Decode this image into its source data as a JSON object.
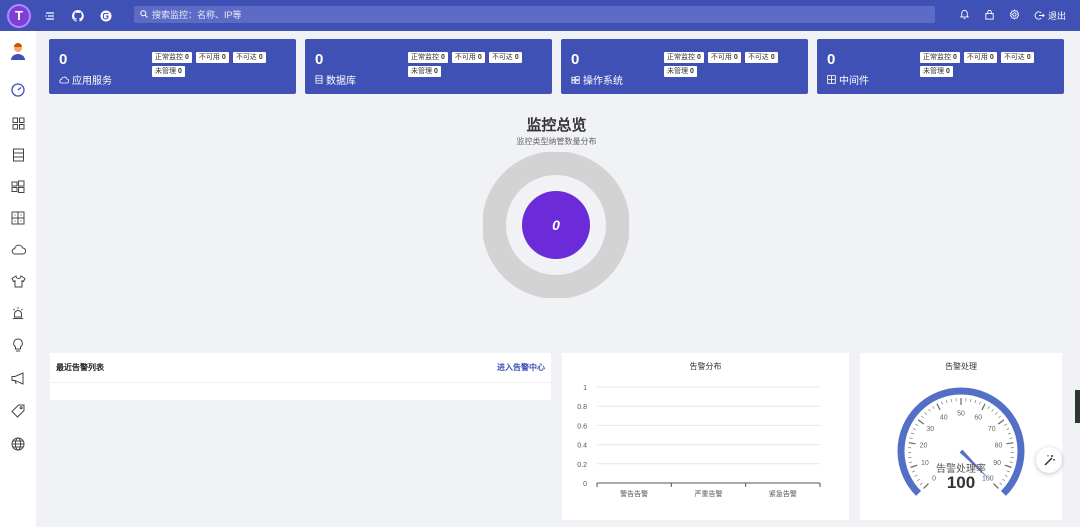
{
  "header": {
    "logo_char": "T",
    "search_placeholder": "搜索监控：名称、IP等",
    "logout_label": "退出"
  },
  "sidebar": {
    "items": [
      {
        "icon": "avatar-icon"
      },
      {
        "icon": "dashboard-icon"
      },
      {
        "icon": "grid-icon"
      },
      {
        "icon": "list-icon"
      },
      {
        "icon": "windows-icon"
      },
      {
        "icon": "component-icon"
      },
      {
        "icon": "cloud-icon"
      },
      {
        "icon": "shirt-icon"
      },
      {
        "icon": "alarm-light-icon"
      },
      {
        "icon": "bulb-icon"
      },
      {
        "icon": "megaphone-icon"
      },
      {
        "icon": "tag-icon"
      },
      {
        "icon": "globe-icon"
      }
    ]
  },
  "cards": [
    {
      "count": "0",
      "name": "应用服务",
      "icon": "cloud-icon",
      "tags": [
        {
          "label": "正常监控",
          "value": "0"
        },
        {
          "label": "不可用",
          "value": "0"
        },
        {
          "label": "不可达",
          "value": "0"
        },
        {
          "label": "未管理",
          "value": "0"
        }
      ]
    },
    {
      "count": "0",
      "name": "数据库",
      "icon": "database-icon",
      "tags": [
        {
          "label": "正常监控",
          "value": "0"
        },
        {
          "label": "不可用",
          "value": "0"
        },
        {
          "label": "不可达",
          "value": "0"
        },
        {
          "label": "未管理",
          "value": "0"
        }
      ]
    },
    {
      "count": "0",
      "name": "操作系统",
      "icon": "windows-icon",
      "tags": [
        {
          "label": "正常监控",
          "value": "0"
        },
        {
          "label": "不可用",
          "value": "0"
        },
        {
          "label": "不可达",
          "value": "0"
        },
        {
          "label": "未管理",
          "value": "0"
        }
      ]
    },
    {
      "count": "0",
      "name": "中间件",
      "icon": "component-icon",
      "tags": [
        {
          "label": "正常监控",
          "value": "0"
        },
        {
          "label": "不可用",
          "value": "0"
        },
        {
          "label": "不可达",
          "value": "0"
        },
        {
          "label": "未管理",
          "value": "0"
        }
      ]
    }
  ],
  "overview": {
    "title": "监控总览",
    "subtitle": "监控类型纳管数量分布",
    "center_value": "0"
  },
  "alarm_list": {
    "title": "最近告警列表",
    "link": "进入告警中心"
  },
  "alarm_distribution": {
    "title": "告警分布",
    "y_ticks": [
      "1",
      "0.8",
      "0.6",
      "0.4",
      "0.2",
      "0"
    ],
    "categories": [
      "警告告警",
      "严重告警",
      "紧急告警"
    ]
  },
  "alarm_handling": {
    "title": "告警处理",
    "gauge_label": "告警处理率",
    "gauge_value": "100",
    "gauge_ticks": [
      "0",
      "10",
      "20",
      "30",
      "40",
      "50",
      "60",
      "70",
      "80",
      "90",
      "100"
    ]
  },
  "chart_data": [
    {
      "type": "donut",
      "title": "监控总览",
      "subtitle": "监控类型纳管数量分布",
      "center_value": 0,
      "values": []
    },
    {
      "type": "bar",
      "title": "告警分布",
      "categories": [
        "警告告警",
        "严重告警",
        "紧急告警"
      ],
      "values": [
        0,
        0,
        0
      ],
      "ylim": [
        0,
        1
      ],
      "grid": true
    },
    {
      "type": "gauge",
      "title": "告警处理",
      "label": "告警处理率",
      "value": 100,
      "range": [
        0,
        100
      ]
    }
  ],
  "colors": {
    "primary": "#3f51b5",
    "donut_center": "#6c2bd9",
    "donut_ring": "#d3d3d3",
    "gauge": "#5470c6"
  }
}
